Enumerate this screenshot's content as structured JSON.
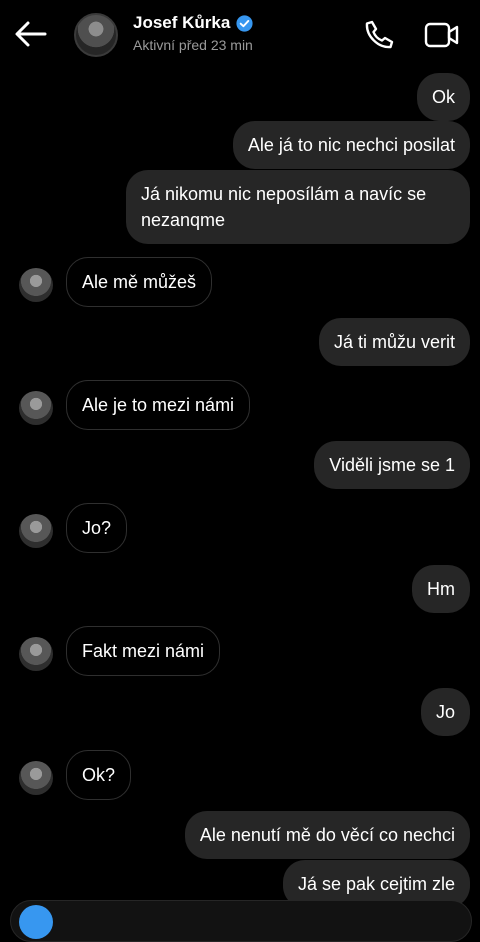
{
  "header": {
    "back_icon": "arrow-left-icon",
    "name": "Josef Kůrka",
    "verified_icon": "verified-badge-icon",
    "status": "Aktivní před 23 min",
    "call_icon": "phone-icon",
    "video_icon": "video-camera-icon"
  },
  "messages": [
    {
      "direction": "outgoing",
      "text": "Ok"
    },
    {
      "direction": "outgoing",
      "text": "Ale já to nic nechci posilat"
    },
    {
      "direction": "outgoing",
      "text": "Já nikomu nic neposílám a navíc se nezanqme"
    },
    {
      "direction": "incoming",
      "text": "Ale mě můžeš"
    },
    {
      "direction": "outgoing",
      "text": "Já ti můžu verit"
    },
    {
      "direction": "incoming",
      "text": "Ale je to mezi námi"
    },
    {
      "direction": "outgoing",
      "text": "Viděli jsme se 1"
    },
    {
      "direction": "incoming",
      "text": "Jo?"
    },
    {
      "direction": "outgoing",
      "text": "Hm"
    },
    {
      "direction": "incoming",
      "text": "Fakt mezi námi"
    },
    {
      "direction": "outgoing",
      "text": "Jo"
    },
    {
      "direction": "incoming",
      "text": "Ok?"
    },
    {
      "direction": "outgoing",
      "text": "Ale nenutí mě do věcí co nechci"
    },
    {
      "direction": "outgoing",
      "text": "Já se pak cejtim zle"
    }
  ],
  "colors": {
    "background": "#000000",
    "outgoing_bubble": "#262626",
    "incoming_border": "#2f2f2f",
    "verified": "#3797f0",
    "status_text": "#9a9a9a"
  }
}
